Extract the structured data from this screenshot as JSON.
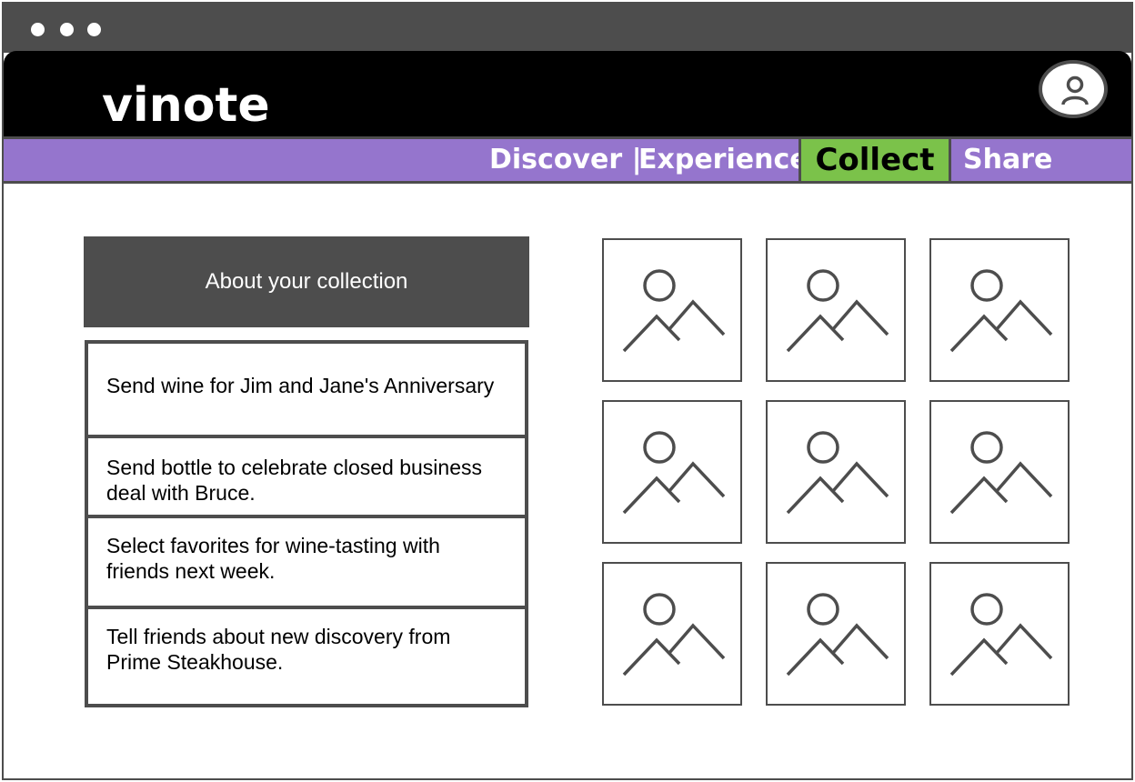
{
  "window": {
    "controls": [
      "dot",
      "dot",
      "dot"
    ]
  },
  "app": {
    "brand": "vinote",
    "avatar_icon": "user-icon"
  },
  "nav": {
    "items": [
      {
        "label": "Discover |",
        "active": false
      },
      {
        "label": "Experience.",
        "active": false
      },
      {
        "label": "Collect",
        "active": true
      },
      {
        "label": "Share",
        "active": false
      }
    ],
    "bar_color": "#9575cd",
    "active_color": "#7bc24a"
  },
  "sidebar": {
    "header": "About  your collection",
    "items": [
      {
        "text": "Send wine for Jim and Jane's Anniversary"
      },
      {
        "text": "Send bottle to celebrate closed business deal with Bruce."
      },
      {
        "text": "Select favorites for wine-tasting with friends next week."
      },
      {
        "text": "Tell friends about new discovery from Prime Steakhouse."
      }
    ]
  },
  "gallery": {
    "tiles": [
      {
        "icon": "image-placeholder-icon"
      },
      {
        "icon": "image-placeholder-icon"
      },
      {
        "icon": "image-placeholder-icon"
      },
      {
        "icon": "image-placeholder-icon"
      },
      {
        "icon": "image-placeholder-icon"
      },
      {
        "icon": "image-placeholder-icon"
      },
      {
        "icon": "image-placeholder-icon"
      },
      {
        "icon": "image-placeholder-icon"
      },
      {
        "icon": "image-placeholder-icon"
      }
    ]
  }
}
